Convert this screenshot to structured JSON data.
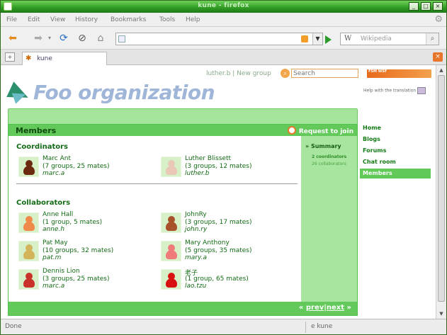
{
  "window": {
    "title": "kune - firefox"
  },
  "menubar": {
    "items": [
      "File",
      "Edit",
      "View",
      "History",
      "Bookmarks",
      "Tools",
      "Help"
    ]
  },
  "search_engine": {
    "placeholder": "Wikipedia"
  },
  "tab": {
    "label": "kune"
  },
  "statusbar": {
    "left": "Done",
    "right": "e   kune"
  },
  "page": {
    "user_link": "luther.b",
    "separator": " | ",
    "new_group": "New group",
    "search_placeholder": "Search",
    "badge": "FSM WSF",
    "help_translation": "Help with the translation",
    "org_name": "Foo organization",
    "box_title": "Members",
    "request_join": "Request to join",
    "coordinators_title": "Coordinators",
    "collaborators_title": "Collaborators",
    "coordinators": [
      {
        "name": "Marc Ant",
        "groups": "(7 groups, 25 mates)",
        "user": "marc.a",
        "color": "#6b2a10"
      },
      {
        "name": "Luther Blissett",
        "groups": "(3 groups, 12 mates)",
        "user": "luther.b",
        "color": "#e9c8b8"
      }
    ],
    "collaborators": [
      {
        "name": "Anne Hall",
        "groups": "(1 group, 5 mates)",
        "user": "anne.h",
        "color": "#f08a4a"
      },
      {
        "name": "JohnRy",
        "groups": "(3 groups, 17 mates)",
        "user": "john.ry",
        "color": "#a7522a"
      },
      {
        "name": "Pat May",
        "groups": "(10 groups, 32 mates)",
        "user": "pat.m",
        "color": "#d4b45a"
      },
      {
        "name": "Mary Anthony",
        "groups": "(5 groups, 35 mates)",
        "user": "mary.a",
        "color": "#f07a7a"
      },
      {
        "name": "Dennis Lion",
        "groups": "(3 groups, 25 mates)",
        "user": "marc.a",
        "color": "#c8322a"
      },
      {
        "name": "老子",
        "groups": "(1 group, 65 mates)",
        "user": "lao.tzu",
        "color": "#d81010"
      }
    ],
    "summary": {
      "title": "» Summary",
      "coordinators": "2 coordinators",
      "collaborators": "26 collaborators"
    },
    "pager": {
      "prefix": "«",
      "prev": "prev",
      "sep": "|",
      "next": "next",
      "suffix": "»"
    },
    "nav": [
      "Home",
      "Blogs",
      "Forums",
      "Chat room",
      "Members"
    ]
  }
}
